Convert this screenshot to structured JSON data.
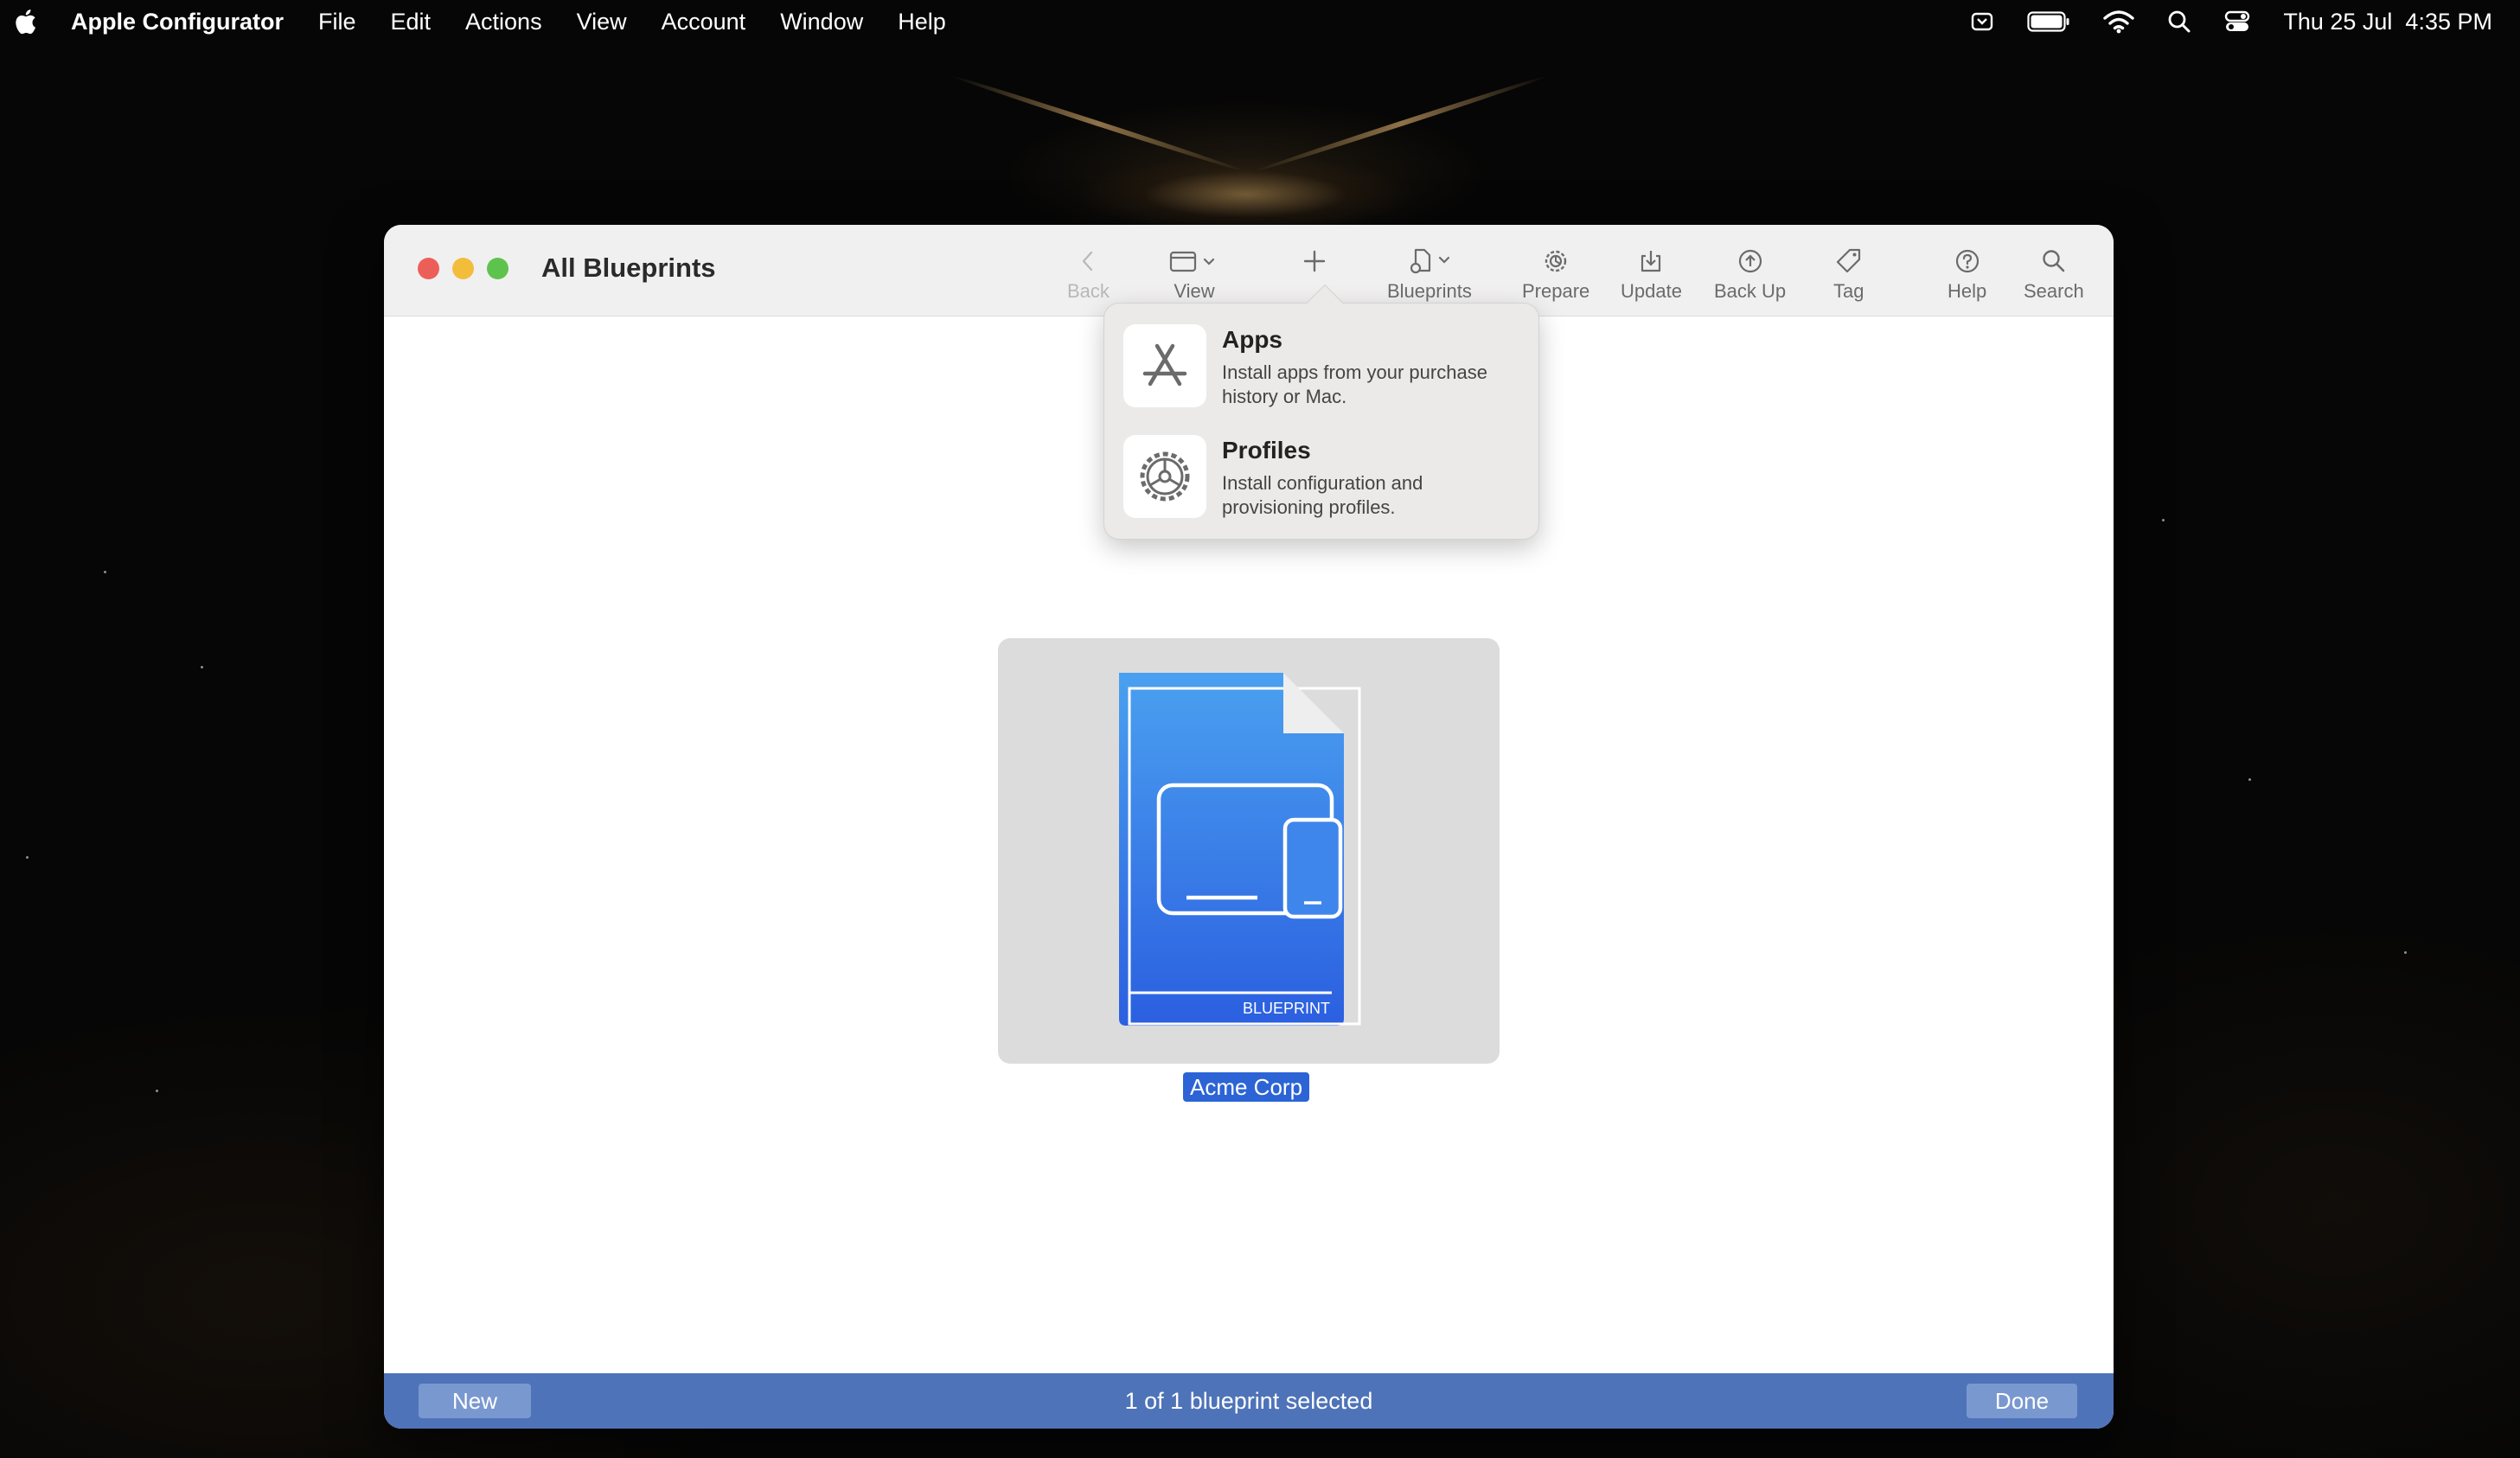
{
  "menubar": {
    "app_name": "Apple Configurator",
    "items": [
      "File",
      "Edit",
      "Actions",
      "View",
      "Account",
      "Window",
      "Help"
    ],
    "datetime": "Thu 25 Jul  4:35 PM"
  },
  "window": {
    "title": "All Blueprints",
    "toolbar": {
      "back": "Back",
      "view": "View",
      "add": "+",
      "blueprints": "Blueprints",
      "prepare": "Prepare",
      "update": "Update",
      "back_up": "Back Up",
      "tag": "Tag",
      "help": "Help",
      "search": "Search"
    },
    "popover": {
      "items": [
        {
          "title": "Apps",
          "description": "Install apps from your purchase history or Mac.",
          "icon": "app-store-icon"
        },
        {
          "title": "Profiles",
          "description": "Install configuration and provisioning profiles.",
          "icon": "gear-icon"
        }
      ]
    },
    "blueprint": {
      "name": "Acme Corp",
      "badge": "BLUEPRINT"
    },
    "bottombar": {
      "new_label": "New",
      "status": "1 of 1 blueprint selected",
      "done_label": "Done"
    }
  },
  "colors": {
    "selection": "#2c64d6",
    "bottombar": "#4e73b8",
    "blueprint_top": "#4aa0f0",
    "blueprint_bottom": "#2b5fe0"
  }
}
